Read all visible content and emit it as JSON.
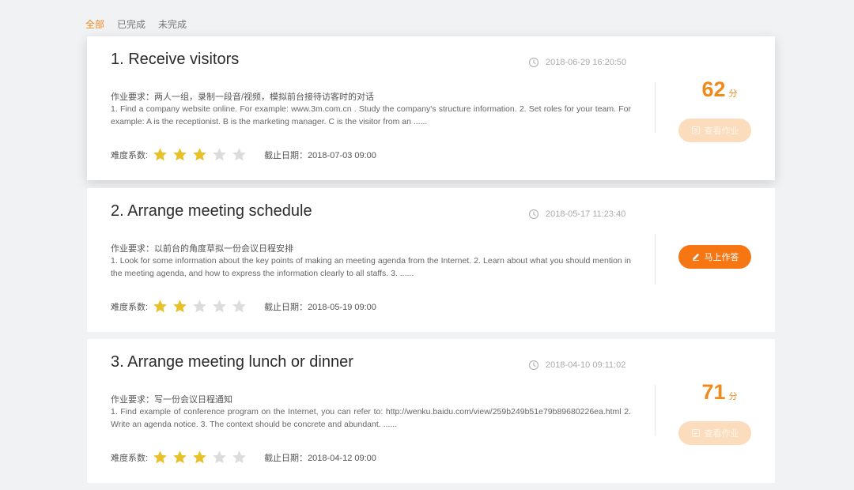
{
  "tabs": [
    {
      "label": "全部",
      "active": true
    },
    {
      "label": "已完成",
      "active": false
    },
    {
      "label": "未完成",
      "active": false
    }
  ],
  "labels": {
    "requirement_prefix": "作业要求：",
    "difficulty": "难度系数:",
    "deadline_prefix": "截止日期：",
    "score_unit": "分"
  },
  "assignments": [
    {
      "title": "1. Receive visitors",
      "time": "2018-06-29 16:20:50",
      "requirement": "两人一组，录制一段音/视频，模拟前台接待访客时的对话",
      "description": "1. Find a company website online. For example: www.3m.com.cn . Study the company's structure information.   2. Set roles for your team. For example: A is the receptionist. B is the marketing manager. C is the visitor from an ......",
      "difficulty": 3,
      "deadline": "2018-07-03 09:00",
      "score": "62",
      "button_label": "查看作业",
      "button_icon": "view-icon"
    },
    {
      "title": "2. Arrange meeting schedule",
      "time": "2018-05-17 11:23:40",
      "requirement": "以前台的角度草拟一份会议日程安排",
      "description": "1. Look for some information about the key points of making an meeting agenda from the Internet.   2. Learn about what you should mention in the meeting agenda, and how to express the information clearly to all staffs.   3. ......",
      "difficulty": 2,
      "deadline": "2018-05-19 09:00",
      "score": "",
      "button_label": "马上作答",
      "button_icon": "pencil-icon"
    },
    {
      "title": "3. Arrange meeting lunch or dinner",
      "time": "2018-04-10 09:11:02",
      "requirement": "写一份会议日程通知",
      "description": "1. Find example of conference program on the Internet, you can refer to: http://wenku.baidu.com/view/259b249b51e79b89680226ea.html   2. Write an agenda notice.   3. The context should be concrete and abundant. ......",
      "difficulty": 3,
      "deadline": "2018-04-12 09:00",
      "score": "71",
      "button_label": "查看作业",
      "button_icon": "view-icon"
    }
  ],
  "colors": {
    "accent": "#f08a1c",
    "star_on": "#e8c12a",
    "star_off": "#dcdcdc",
    "button_active": "#f57613",
    "button_muted": "#fbdcbc"
  }
}
